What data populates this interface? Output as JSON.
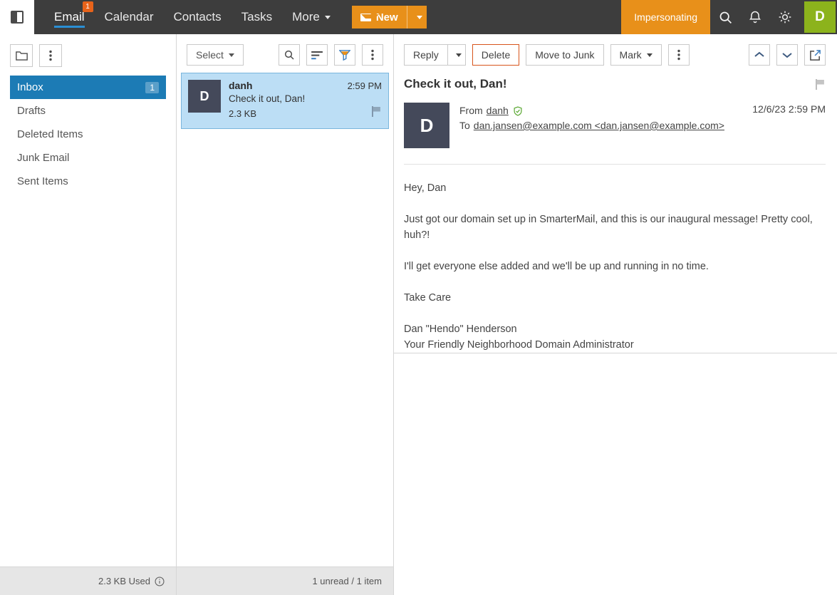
{
  "header": {
    "panel_toggle_icon": "panel-toggle-icon",
    "tabs": [
      {
        "label": "Email",
        "badge": "1",
        "active": true
      },
      {
        "label": "Calendar",
        "badge": "",
        "active": false
      },
      {
        "label": "Contacts",
        "badge": "",
        "active": false
      },
      {
        "label": "Tasks",
        "badge": "",
        "active": false
      },
      {
        "label": "More",
        "badge": "",
        "active": false
      }
    ],
    "new_button": {
      "label": "New",
      "icon": "envelope-icon",
      "caret_icon": "chevron-down-icon"
    },
    "impersonating_label": "Impersonating",
    "search_icon": "search-icon",
    "notifications_icon": "bell-icon",
    "theme_icon": "brightness-icon",
    "avatar_initial": "D"
  },
  "sidebar": {
    "new_folder_icon": "folder-icon",
    "more_icon": "kebab-menu-icon",
    "folders": [
      {
        "label": "Inbox",
        "count": "1",
        "active": true
      },
      {
        "label": "Drafts",
        "count": "",
        "active": false
      },
      {
        "label": "Deleted Items",
        "count": "",
        "active": false
      },
      {
        "label": "Junk Email",
        "count": "",
        "active": false
      },
      {
        "label": "Sent Items",
        "count": "",
        "active": false
      }
    ],
    "status": {
      "text": "2.3 KB Used",
      "info_icon": "info-icon"
    }
  },
  "message_list": {
    "select_label": "Select",
    "select_caret_icon": "chevron-down-icon",
    "search_icon": "search-icon",
    "sort_icon": "sort-icon",
    "filter_icon": "filter-icon",
    "more_icon": "kebab-menu-icon",
    "items": [
      {
        "avatar_initial": "D",
        "from": "danh",
        "time": "2:59 PM",
        "subject": "Check it out, Dan!",
        "size": "2.3 KB",
        "flag_icon": "flag-icon",
        "selected": true
      }
    ],
    "status": "1 unread / 1 item"
  },
  "reading_pane": {
    "toolbar": {
      "reply_label": "Reply",
      "reply_caret_icon": "chevron-down-icon",
      "delete_label": "Delete",
      "move_to_junk_label": "Move to Junk",
      "mark_label": "Mark",
      "mark_caret_icon": "chevron-down-icon",
      "more_icon": "kebab-menu-icon",
      "prev_icon": "chevron-up-icon",
      "next_icon": "chevron-down-icon",
      "popout_icon": "open-in-new-window-icon"
    },
    "subject": "Check it out, Dan!",
    "flag_icon": "flag-icon",
    "avatar_initial": "D",
    "from_label": "From",
    "from_value": "danh",
    "verified_icon": "verified-shield-icon",
    "to_label": "To",
    "to_value": "dan.jansen@example.com <dan.jansen@example.com>",
    "date": "12/6/23 2:59 PM",
    "body": [
      "Hey, Dan",
      "Just got our domain set up in SmarterMail, and this is our inaugural message! Pretty cool, huh?!",
      "I'll get everyone else added and we'll be up and running in no time.",
      "Take Care",
      "Dan \"Hendo\" Henderson",
      "Your Friendly Neighborhood Domain Administrator"
    ]
  },
  "colors": {
    "header_bg": "#3d3d3d",
    "accent_orange": "#e8901a",
    "accent_blue": "#1c7bb5",
    "selected_row": "#bcdef5",
    "avatar_green": "#8cb31c",
    "avatar_dark": "#44495a",
    "danger_border": "#d8551c"
  }
}
